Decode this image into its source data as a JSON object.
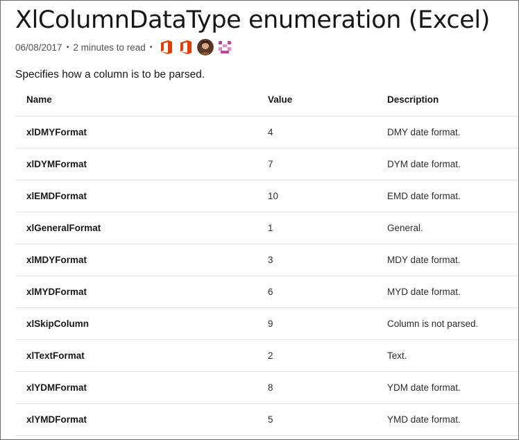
{
  "title": "XlColumnDataType enumeration (Excel)",
  "meta": {
    "date": "06/08/2017",
    "separator": "•",
    "read_time": "2 minutes to read",
    "contributor_icons": [
      "office-icon",
      "office-icon",
      "contributor-avatar",
      "contributor-avatar"
    ]
  },
  "intro": "Specifies how a column is to be parsed.",
  "table": {
    "headers": [
      "Name",
      "Value",
      "Description"
    ],
    "rows": [
      {
        "name": "xlDMYFormat",
        "value": "4",
        "description": "DMY date format."
      },
      {
        "name": "xlDYMFormat",
        "value": "7",
        "description": "DYM date format."
      },
      {
        "name": "xlEMDFormat",
        "value": "10",
        "description": "EMD date format."
      },
      {
        "name": "xlGeneralFormat",
        "value": "1",
        "description": "General."
      },
      {
        "name": "xlMDYFormat",
        "value": "3",
        "description": "MDY date format."
      },
      {
        "name": "xlMYDFormat",
        "value": "6",
        "description": "MYD date format."
      },
      {
        "name": "xlSkipColumn",
        "value": "9",
        "description": "Column is not parsed."
      },
      {
        "name": "xlTextFormat",
        "value": "2",
        "description": "Text."
      },
      {
        "name": "xlYDMFormat",
        "value": "8",
        "description": "YDM date format."
      },
      {
        "name": "xlYMDFormat",
        "value": "5",
        "description": "YMD date format."
      }
    ]
  },
  "colors": {
    "office_orange": "#eb3c00",
    "avatar_pink": "#c2449a"
  }
}
